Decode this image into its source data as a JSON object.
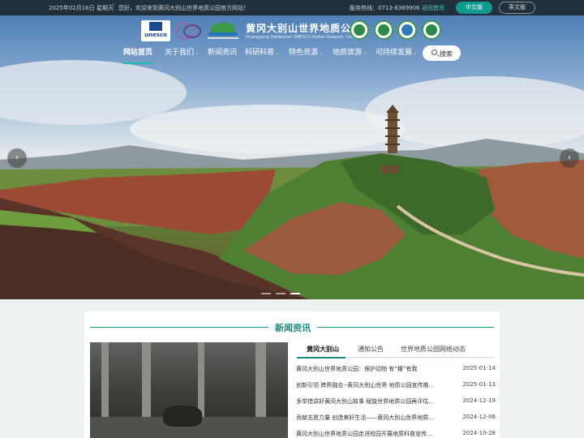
{
  "topbar": {
    "date": "2025年02月16日 星期天",
    "welcome": "您好，欢迎来到黄冈大别山世界地质公园官方网站！",
    "hotline": "服务热线：0713-8369906",
    "home_link": "返回首页",
    "lang_zh": "中文版",
    "lang_en": "英文版"
  },
  "header": {
    "unesco_text": "unesco",
    "title_cn": "黄冈大别山世界地质公园",
    "title_en": "Huanggang Dabieshan UNESCO Global Geopark, China"
  },
  "nav": {
    "items": [
      {
        "label": "网站首页",
        "has_caret": false
      },
      {
        "label": "关于我们",
        "has_caret": true
      },
      {
        "label": "新闻资讯",
        "has_caret": false
      },
      {
        "label": "科研科普",
        "has_caret": true
      },
      {
        "label": "特色资源",
        "has_caret": true
      },
      {
        "label": "地质旅游",
        "has_caret": true
      },
      {
        "label": "可持续发展",
        "has_caret": true
      }
    ],
    "caret_glyph": "⌄",
    "search_label": "搜索"
  },
  "carousel": {
    "prev_glyph": "‹",
    "next_glyph": "›",
    "slide_count": 3,
    "active_slide": 3
  },
  "news": {
    "heading": "新闻资讯",
    "tabs": [
      "黄冈大别山",
      "通知公告",
      "世界地质公园网络动态"
    ],
    "items": [
      {
        "title": "黄冈大别山世界地质公园：保护动物 有“獾”有我",
        "date": "2025-01-14"
      },
      {
        "title": "创新引领 跨界融合--黄冈大别山世界 地质公园宣传推…",
        "date": "2025-01-13"
      },
      {
        "title": "多举措讲好黄冈大别山故事 赋能世界地质公园再评估…",
        "date": "2024-12-19"
      },
      {
        "title": "贡献志愿力量 创造美好生活——黄冈大别山世界地质…",
        "date": "2024-12-06"
      },
      {
        "title": "黄冈大别山世界地质公园走进校园开展地质科普宣传…",
        "date": "2024-10-28"
      }
    ]
  },
  "colors": {
    "accent": "#178b80",
    "topbar_bg": "#22303c",
    "lang_active": "#109a90"
  }
}
